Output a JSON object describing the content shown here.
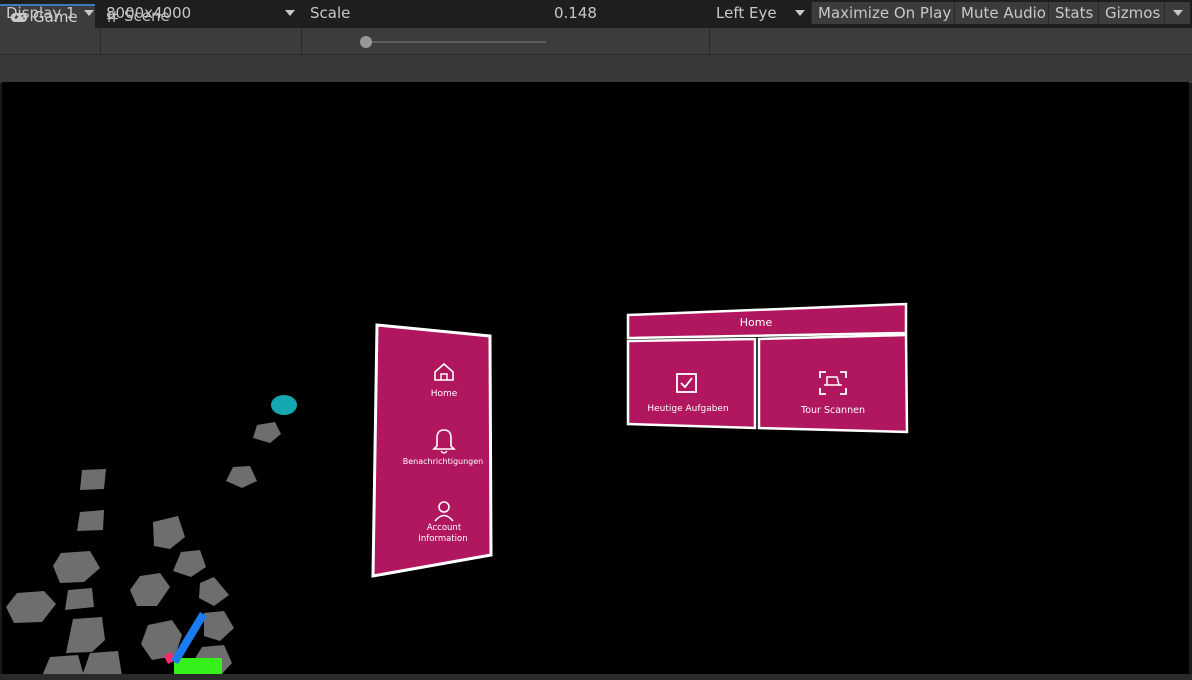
{
  "tabs": [
    {
      "label": "Game",
      "icon": "gamepad-icon",
      "active": true
    },
    {
      "label": "Scene",
      "icon": "hash-icon",
      "active": false
    }
  ],
  "toolbar": {
    "display": "Display 1",
    "resolution": "8000x4000",
    "scale_label": "Scale",
    "scale_value": "0.148",
    "eye": "Left Eye",
    "maximize": "Maximize On Play",
    "mute": "Mute Audio",
    "stats": "Stats",
    "gizmos": "Gizmos"
  },
  "scene": {
    "side_menu": {
      "items": [
        {
          "label": "Home",
          "icon": "home-icon"
        },
        {
          "label": "Benachrichtigungen",
          "icon": "bell-icon"
        },
        {
          "label_line1": "Account",
          "label_line2": "Information",
          "icon": "user-icon"
        }
      ]
    },
    "home_panel": {
      "title": "Home",
      "buttons": [
        {
          "label": "Heutige Aufgaben",
          "icon": "checkbox-icon"
        },
        {
          "label": "Tour Scannen",
          "icon": "scan-icon"
        }
      ]
    },
    "colors": {
      "panel": "#b0175e",
      "border": "#ffffff",
      "rock": "#6e6e6e",
      "marker": "#16a8b0",
      "gizmo_blue": "#1a7cf0",
      "gizmo_green": "#35f01b",
      "gizmo_pink": "#ff2a6a"
    }
  }
}
